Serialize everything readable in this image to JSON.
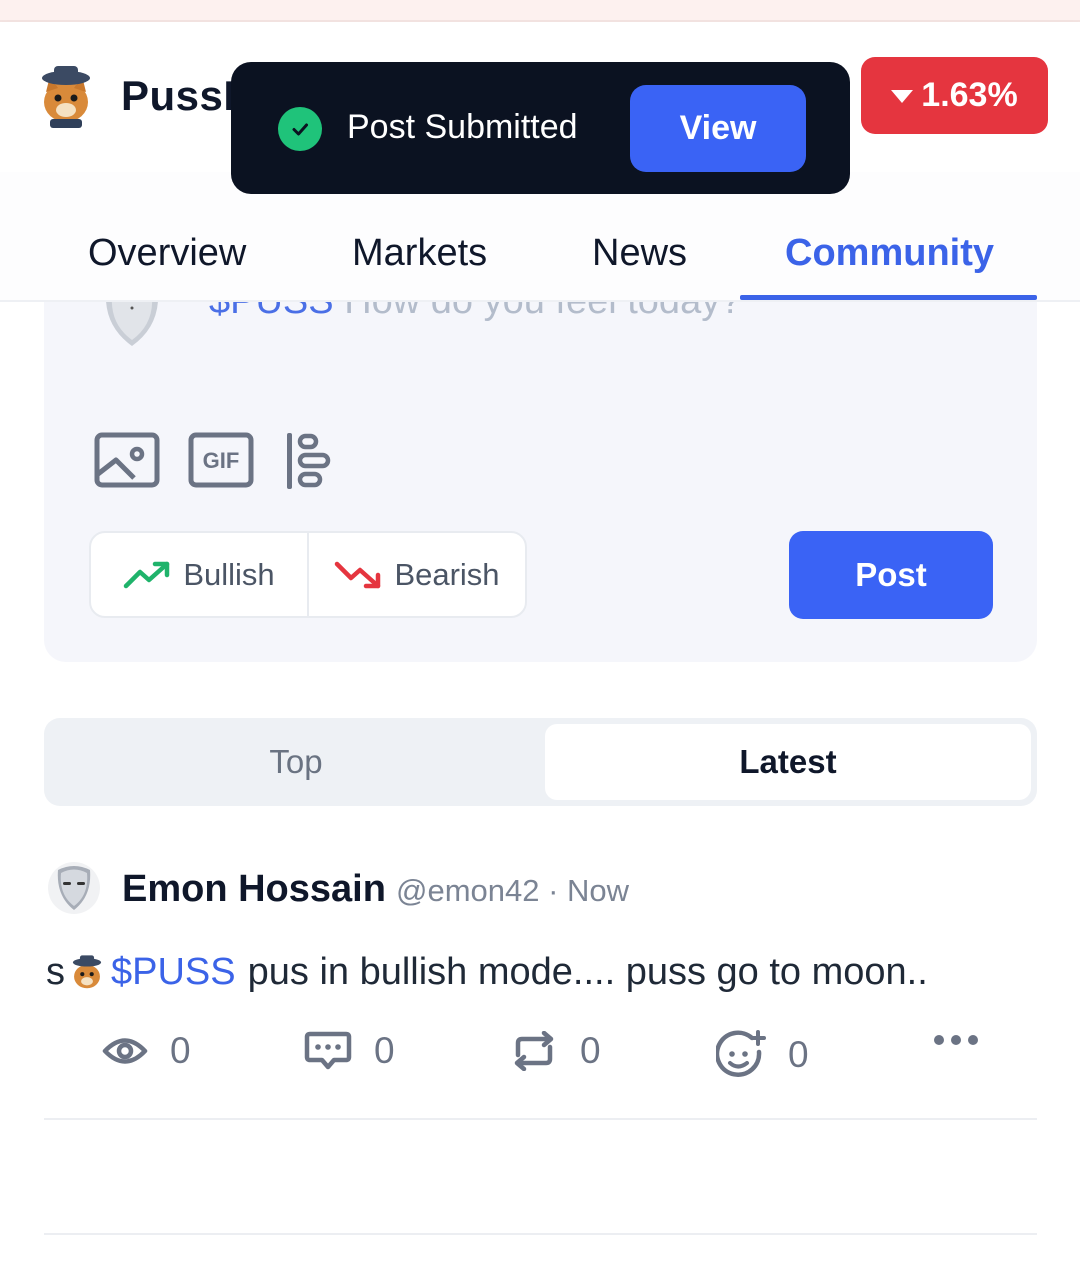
{
  "header": {
    "app_name": "PussF",
    "price_change": "1.63%",
    "price_direction": "down",
    "down_color": "#e5353f"
  },
  "toast": {
    "message": "Post Submitted",
    "view_label": "View",
    "status_icon": "check-circle-icon"
  },
  "nav": {
    "tabs": [
      {
        "label": "Overview"
      },
      {
        "label": "Markets"
      },
      {
        "label": "News"
      },
      {
        "label": "Community"
      }
    ],
    "active_tab": "Community",
    "accent_color": "#3b63e8"
  },
  "composer": {
    "ticker": "$PUSS",
    "placeholder": "How do you feel today?",
    "tools": [
      "image-icon",
      "gif-icon",
      "poll-icon"
    ],
    "bullish_label": "Bullish",
    "bearish_label": "Bearish",
    "post_label": "Post"
  },
  "feed_sort": {
    "options": [
      {
        "label": "Top"
      },
      {
        "label": "Latest"
      }
    ],
    "selected": "Latest"
  },
  "posts": [
    {
      "author": "Emon Hossain",
      "handle": "@emon42 · Now",
      "text_prefix": "s",
      "ticker": "$PUSS",
      "text": "pus in bullish mode.... puss go to moon..",
      "views": "0",
      "comments": "0",
      "reposts": "0",
      "reactions": "0"
    }
  ]
}
